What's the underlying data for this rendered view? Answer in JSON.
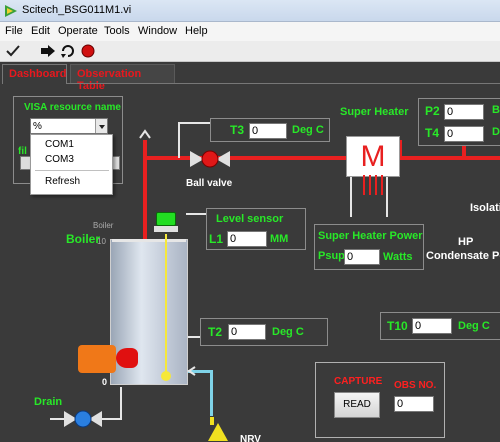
{
  "window": {
    "title": "Scitech_BSG011M1.vi"
  },
  "menu": [
    "File",
    "Edit",
    "Operate",
    "Tools",
    "Window",
    "Help"
  ],
  "toolbar": {
    "icons": [
      "run-check-icon",
      "run-arrow-icon",
      "run-continuously-icon",
      "abort-stop-icon"
    ]
  },
  "tabs": [
    {
      "label": "Dashboard",
      "active": true
    },
    {
      "label": "Observation Table",
      "active": false
    }
  ],
  "visa": {
    "label": "VISA resource name",
    "prefix": "%",
    "value": "",
    "options": [
      "COM1",
      "COM3",
      "Refresh"
    ],
    "file_label_partial": "fil"
  },
  "ball_valve": {
    "label": "Ball valve"
  },
  "t3": {
    "label": "T3",
    "value": "0",
    "unit": "Deg C"
  },
  "super_heater": {
    "label": "Super Heater",
    "symbol": "M"
  },
  "p2": {
    "label": "P2",
    "value": "0",
    "unit_partial": "B"
  },
  "t4": {
    "label": "T4",
    "value": "0",
    "unit_partial": "D"
  },
  "level_sensor": {
    "label": "Level sensor",
    "field_label": "L1",
    "value": "0",
    "unit": "MM"
  },
  "boiler": {
    "label": "Boiler",
    "small_label": "Boiler",
    "scale_top": "10",
    "scale_bottom": "0"
  },
  "super_heater_power": {
    "label": "Super Heater Power",
    "field_label": "Psup",
    "value": "0",
    "unit": "Watts"
  },
  "isolation_partial": "Isolati",
  "hp": {
    "line1": "HP",
    "line2": "Condensate Po"
  },
  "t2": {
    "label": "T2",
    "value": "0",
    "unit": "Deg C"
  },
  "t10": {
    "label": "T10",
    "value": "0",
    "unit": "Deg C"
  },
  "capture": {
    "label": "CAPTURE",
    "button": "READ",
    "obs_label": "OBS NO.",
    "obs_value": "0"
  },
  "drain": {
    "label": "Drain"
  },
  "nrv_partial": "NRV",
  "colors": {
    "panel": "#3a3a3a",
    "label_green": "#28e828",
    "pipe_red": "#e82020",
    "tab_red": "#e8181e"
  }
}
